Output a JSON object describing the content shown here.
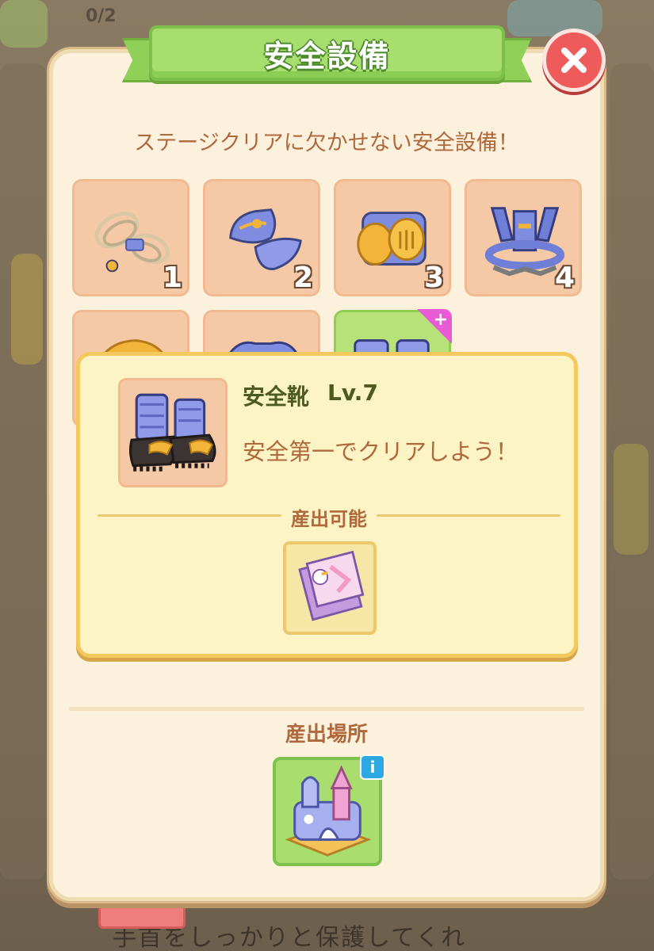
{
  "header": {
    "title": "安全設備",
    "close_label": "×"
  },
  "subtitle": "ステージクリアに欠かせない安全設備！",
  "equipment": [
    {
      "name": "rope",
      "count": "1",
      "icon": "rope-icon"
    },
    {
      "name": "wrist-guard",
      "count": "2",
      "icon": "wrist-guard-icon"
    },
    {
      "name": "knee-pad",
      "count": "3",
      "icon": "knee-pad-icon"
    },
    {
      "name": "harness",
      "count": "4",
      "icon": "harness-icon"
    },
    {
      "name": "helmet",
      "count": "",
      "icon": "helmet-icon"
    },
    {
      "name": "vest",
      "count": "",
      "icon": "vest-icon"
    },
    {
      "name": "boots",
      "count": "",
      "icon": "boots-icon",
      "upgrade": "+"
    }
  ],
  "detail": {
    "name": "安全靴",
    "level": "Lv.7",
    "description": "安全第一でクリアしよう！",
    "products_label": "産出可能",
    "product_icon": "ticket-icon"
  },
  "location": {
    "label": "産出場所",
    "icon": "bouncy-castle-icon",
    "info": "i"
  },
  "background": {
    "counter": "0/2",
    "bottom_text": "手首をしっかりと保護してくれ"
  },
  "colors": {
    "panel": "#fbf1dd",
    "ribbon": "#a8de6d",
    "close": "#ef5b5b",
    "slot": "#f6c9a6",
    "detail": "#fdf4c6",
    "text_brown": "#b0683d",
    "text_green": "#4b5a1f"
  }
}
